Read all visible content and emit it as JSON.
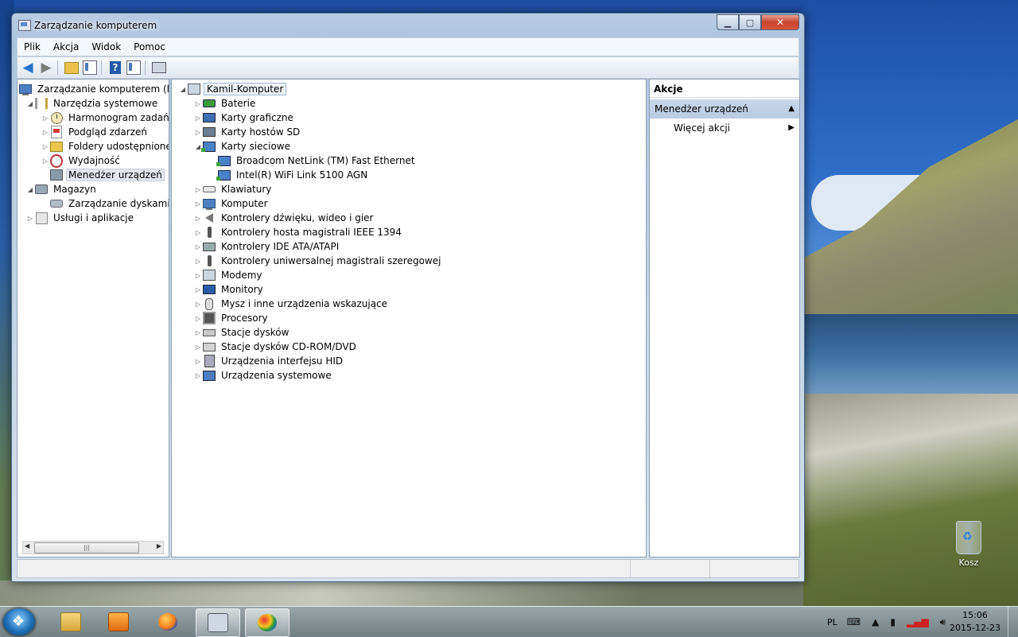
{
  "window": {
    "title": "Zarządzanie komputerem",
    "menu": [
      "Plik",
      "Akcja",
      "Widok",
      "Pomoc"
    ]
  },
  "left_tree": [
    {
      "label": "Zarządzanie komputerem (loka",
      "icon": "computer-management-icon"
    },
    {
      "label": "Narzędzia systemowe",
      "icon": "tools-icon"
    },
    {
      "label": "Harmonogram zadań",
      "icon": "clock-icon"
    },
    {
      "label": "Podgląd zdarzeń",
      "icon": "event-log-icon"
    },
    {
      "label": "Foldery udostępnione",
      "icon": "shared-folder-icon"
    },
    {
      "label": "Wydajność",
      "icon": "performance-icon"
    },
    {
      "label": "Menedżer urządzeń",
      "icon": "device-manager-icon"
    },
    {
      "label": "Magazyn",
      "icon": "storage-icon"
    },
    {
      "label": "Zarządzanie dyskami",
      "icon": "disk-icon"
    },
    {
      "label": "Usługi i aplikacje",
      "icon": "services-icon"
    }
  ],
  "device_tree": {
    "root": "Kamil-Komputer",
    "categories": [
      {
        "label": "Baterie",
        "icon": "battery-icon"
      },
      {
        "label": "Karty graficzne",
        "icon": "display-adapter-icon"
      },
      {
        "label": "Karty hostów SD",
        "icon": "sd-host-icon"
      },
      {
        "label": "Karty sieciowe",
        "icon": "network-adapter-icon"
      },
      {
        "label": "Broadcom NetLink (TM) Fast Ethernet",
        "icon": "network-adapter-icon"
      },
      {
        "label": "Intel(R) WiFi Link 5100 AGN",
        "icon": "network-adapter-icon"
      },
      {
        "label": "Klawiatury",
        "icon": "keyboard-icon"
      },
      {
        "label": "Komputer",
        "icon": "computer-icon"
      },
      {
        "label": "Kontrolery dźwięku, wideo i gier",
        "icon": "sound-icon"
      },
      {
        "label": "Kontrolery hosta magistrali IEEE 1394",
        "icon": "firewire-icon"
      },
      {
        "label": "Kontrolery IDE ATA/ATAPI",
        "icon": "ide-icon"
      },
      {
        "label": "Kontrolery uniwersalnej magistrali szeregowej",
        "icon": "usb-icon"
      },
      {
        "label": "Modemy",
        "icon": "modem-icon"
      },
      {
        "label": "Monitory",
        "icon": "monitor-icon"
      },
      {
        "label": "Mysz i inne urządzenia wskazujące",
        "icon": "mouse-icon"
      },
      {
        "label": "Procesory",
        "icon": "cpu-icon"
      },
      {
        "label": "Stacje dysków",
        "icon": "disk-drive-icon"
      },
      {
        "label": "Stacje dysków CD-ROM/DVD",
        "icon": "cd-drive-icon"
      },
      {
        "label": "Urządzenia interfejsu HID",
        "icon": "hid-icon"
      },
      {
        "label": "Urządzenia systemowe",
        "icon": "system-devices-icon"
      }
    ]
  },
  "actions": {
    "header": "Akcje",
    "section": "Menedżer urządzeń",
    "more": "Więcej akcji"
  },
  "desktop": {
    "recycle_bin": "Kosz"
  },
  "taskbar": {
    "language": "PL",
    "time": "15:06",
    "date": "2015-12-23"
  }
}
